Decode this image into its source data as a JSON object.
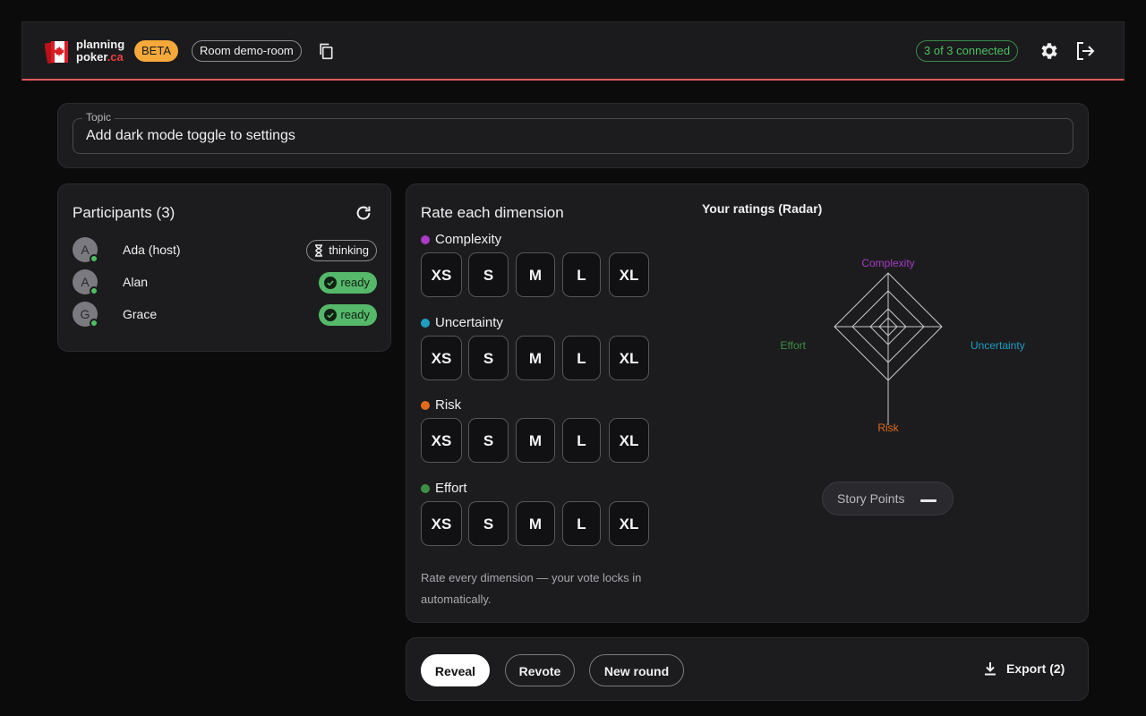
{
  "colors": {
    "accent_red": "#e05a5a",
    "beta": "#f4a93a",
    "ready": "#56b86a",
    "complexity": "#a93bc7",
    "uncertainty": "#1e9fc4",
    "risk": "#e26a1c",
    "effort": "#3d8f44"
  },
  "header": {
    "logo_line1": "planning",
    "logo_line2": "poker",
    "logo_suffix": ".ca",
    "beta": "BETA",
    "room": "Room demo-room",
    "connected": "3 of 3 connected",
    "icons": [
      "copy-icon",
      "gear-icon",
      "logout-icon"
    ]
  },
  "topic": {
    "label": "Topic",
    "value": "Add dark mode toggle to settings"
  },
  "participants": {
    "title": "Participants (3)",
    "list": [
      {
        "initial": "A",
        "name": "Ada (host)",
        "status": "thinking"
      },
      {
        "initial": "A",
        "name": "Alan",
        "status": "ready"
      },
      {
        "initial": "G",
        "name": "Grace",
        "status": "ready"
      }
    ]
  },
  "rating": {
    "title": "Rate each dimension",
    "sizes": [
      "XS",
      "S",
      "M",
      "L",
      "XL"
    ],
    "dimensions": [
      {
        "name": "Complexity",
        "color": "#a93bc7"
      },
      {
        "name": "Uncertainty",
        "color": "#1e9fc4"
      },
      {
        "name": "Risk",
        "color": "#e26a1c"
      },
      {
        "name": "Effort",
        "color": "#3d8f44"
      }
    ],
    "hint": "Rate every dimension — your vote locks in automatically.",
    "radar_title": "Your ratings (Radar)",
    "radar_axes": {
      "top": "Complexity",
      "right": "Uncertainty",
      "bottom": "Risk",
      "left": "Effort"
    },
    "story_points_label": "Story Points"
  },
  "actions": {
    "reveal": "Reveal",
    "revote": "Revote",
    "new_round": "New round",
    "export": "Export (2)"
  }
}
